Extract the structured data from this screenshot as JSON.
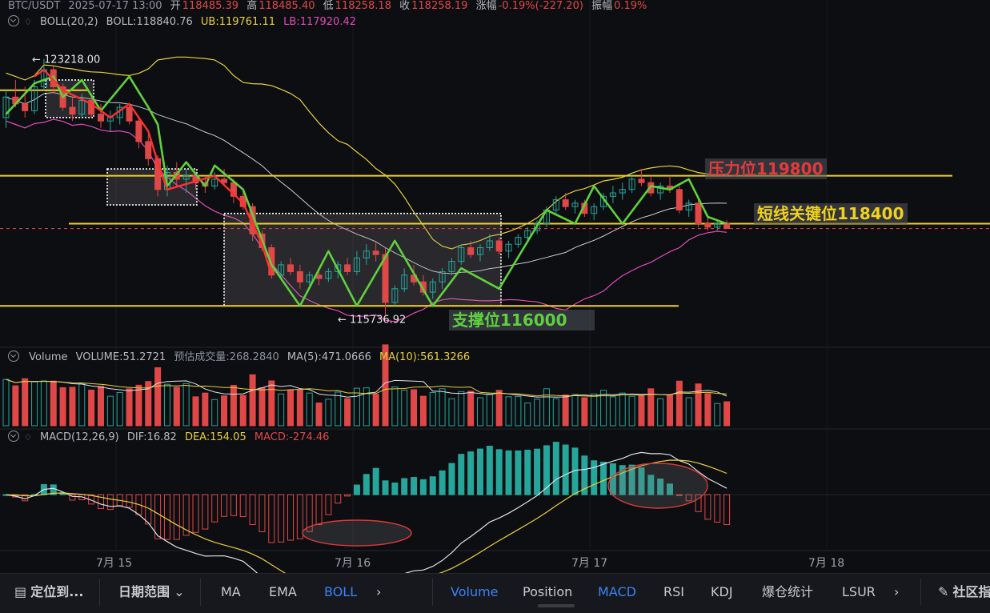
{
  "header": {
    "pair": "BTC/USDT",
    "datetime": "2025-07-17 13:00",
    "open_label": "开",
    "open": "118485.39",
    "high_label": "高",
    "high": "118485.40",
    "low_label": "低",
    "low": "118258.18",
    "close_label": "收",
    "close": "118258.19",
    "change_label": "涨幅",
    "change": "-0.19%(-227.20)",
    "amp_label": "振幅",
    "amp": "0.19%"
  },
  "boll": {
    "name": "BOLL(20,2)",
    "mid": "BOLL:118840.76",
    "ub": "UB:119761.11",
    "lb": "LB:117920.42"
  },
  "volume_panel": {
    "name": "Volume",
    "vol": "VOLUME:51.2721",
    "est": "预估成交量:268.2840",
    "ma5": "MA(5):471.0666",
    "ma10": "MA(10):561.3266"
  },
  "macd_panel": {
    "name": "MACD(12,26,9)",
    "dif": "DIF:16.82",
    "dea": "DEA:154.05",
    "macd": "MACD:-274.46"
  },
  "annotations": {
    "resistance": "压力位119800",
    "short_key": "短线关键位118400",
    "support": "支撑位116000",
    "high_mark": "123218.00",
    "low_mark": "115736.92"
  },
  "bottom_bar": {
    "locate": "定位到...",
    "date_range": "日期范围",
    "main_indicators": [
      "MA",
      "EMA",
      "BOLL"
    ],
    "sub_indicators": [
      "Volume",
      "Position",
      "MACD",
      "RSI",
      "KDJ",
      "爆仓统计",
      "LSUR"
    ],
    "community": "社区指"
  },
  "colors": {
    "up": "#26a69a",
    "down": "#e04848",
    "accent": "#3b82f6",
    "level": "#f2d11e",
    "wave": "#5fd13c",
    "resistance_text": "#e23b3b",
    "bg": "#0d0e12"
  },
  "chart_data": {
    "type": "candlestick",
    "timeframe": "1h",
    "x_ticks": [
      "7月 15",
      "7月 16",
      "7月 17",
      "7月 18"
    ],
    "levels": {
      "resistance": 119800,
      "short_key": 118400,
      "support": 116000
    },
    "price_marks": {
      "high": 123218.0,
      "low": 115736.92
    },
    "candles": [
      [
        121500,
        122300,
        121200,
        122100
      ],
      [
        122100,
        122600,
        121800,
        121900
      ],
      [
        121900,
        122400,
        121500,
        121700
      ],
      [
        121700,
        122600,
        121600,
        122400
      ],
      [
        122400,
        123218,
        122300,
        122900
      ],
      [
        122900,
        123000,
        122200,
        122400
      ],
      [
        122400,
        122500,
        121700,
        121800
      ],
      [
        121800,
        122100,
        121400,
        121600
      ],
      [
        121600,
        122200,
        121500,
        122000
      ],
      [
        122000,
        122200,
        121500,
        121600
      ],
      [
        121600,
        121900,
        121200,
        121400
      ],
      [
        121400,
        121700,
        121100,
        121500
      ],
      [
        121500,
        121900,
        121300,
        121800
      ],
      [
        121800,
        121900,
        121300,
        121400
      ],
      [
        121400,
        121500,
        120600,
        120800
      ],
      [
        120800,
        121000,
        120100,
        120300
      ],
      [
        120300,
        120400,
        119200,
        119400
      ],
      [
        119400,
        120100,
        119200,
        119900
      ],
      [
        119900,
        120200,
        119500,
        119700
      ],
      [
        119700,
        120000,
        119300,
        119800
      ],
      [
        119800,
        119900,
        119400,
        119600
      ],
      [
        119600,
        119800,
        119300,
        119500
      ],
      [
        119500,
        119900,
        119400,
        119700
      ],
      [
        119700,
        120000,
        119500,
        119600
      ],
      [
        119600,
        119700,
        119000,
        119200
      ],
      [
        119200,
        119400,
        118800,
        118900
      ],
      [
        118900,
        119000,
        117900,
        118100
      ],
      [
        118100,
        118200,
        117600,
        117700
      ],
      [
        117700,
        117800,
        116800,
        116900
      ],
      [
        116900,
        117300,
        116800,
        117200
      ],
      [
        117200,
        117400,
        116900,
        117000
      ],
      [
        117000,
        117200,
        116500,
        116700
      ],
      [
        116700,
        117000,
        116500,
        116900
      ],
      [
        116900,
        117000,
        116600,
        116800
      ],
      [
        116800,
        117100,
        116700,
        117000
      ],
      [
        117000,
        117300,
        116800,
        117200
      ],
      [
        117200,
        117400,
        116900,
        117000
      ],
      [
        117000,
        117600,
        116900,
        117400
      ],
      [
        117400,
        117800,
        117200,
        117600
      ],
      [
        117600,
        117900,
        117300,
        117500
      ],
      [
        117500,
        117700,
        115736.92,
        116100
      ],
      [
        116100,
        116600,
        116000,
        116500
      ],
      [
        116500,
        117100,
        116400,
        116900
      ],
      [
        116900,
        117200,
        116600,
        116700
      ],
      [
        116700,
        116900,
        116300,
        116400
      ],
      [
        116400,
        116800,
        116200,
        116700
      ],
      [
        116700,
        117100,
        116500,
        117000
      ],
      [
        117000,
        117400,
        116900,
        117300
      ],
      [
        117300,
        117800,
        117200,
        117700
      ],
      [
        117700,
        117900,
        117400,
        117500
      ],
      [
        117500,
        117800,
        117300,
        117700
      ],
      [
        117700,
        118100,
        117600,
        117900
      ],
      [
        117900,
        118000,
        117500,
        117600
      ],
      [
        117600,
        117900,
        117400,
        117800
      ],
      [
        117800,
        118100,
        117700,
        118000
      ],
      [
        118000,
        118300,
        117900,
        118200
      ],
      [
        118200,
        118500,
        118100,
        118400
      ],
      [
        118400,
        118900,
        118300,
        118800
      ],
      [
        118800,
        119200,
        118700,
        119100
      ],
      [
        119100,
        119300,
        118800,
        118900
      ],
      [
        118900,
        119100,
        118700,
        119000
      ],
      [
        119000,
        119100,
        118600,
        118700
      ],
      [
        118700,
        119000,
        118500,
        118900
      ],
      [
        118900,
        119300,
        118800,
        119200
      ],
      [
        119200,
        119500,
        119000,
        119300
      ],
      [
        119300,
        119600,
        119100,
        119400
      ],
      [
        119400,
        119900,
        119300,
        119700
      ],
      [
        119700,
        120000,
        119500,
        119600
      ],
      [
        119600,
        119800,
        119200,
        119300
      ],
      [
        119300,
        119600,
        119100,
        119500
      ],
      [
        119500,
        119800,
        119300,
        119400
      ],
      [
        119400,
        119500,
        118700,
        118800
      ],
      [
        118800,
        119100,
        118600,
        119000
      ],
      [
        119000,
        119100,
        118300,
        118400
      ],
      [
        118400,
        118600,
        118200,
        118300
      ],
      [
        118300,
        118500,
        118200,
        118400
      ],
      [
        118400,
        118500,
        118258.18,
        118258.19
      ]
    ],
    "volume_y_max": 1500,
    "macd_y_range": [
      -600,
      500
    ]
  }
}
